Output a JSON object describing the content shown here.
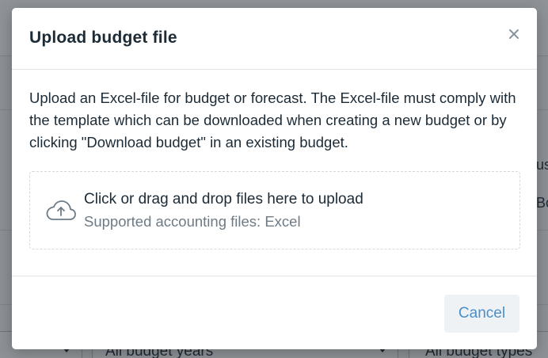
{
  "background": {
    "partial_header_1": "usi",
    "partial_cell_1": "Bo",
    "filters": {
      "budget_years": "All budget years",
      "budget_types": "All budget types"
    }
  },
  "modal": {
    "title": "Upload budget file",
    "close_icon": "close-icon",
    "description": "Upload an Excel-file for budget or forecast. The Excel-file must comply with the template which can be downloaded when creating a new budget or by clicking \"Download budget\" in an existing budget.",
    "dropzone": {
      "icon": "cloud-upload-icon",
      "title": "Click or drag and drop files here to upload",
      "subtitle": "Supported accounting files: Excel"
    },
    "footer": {
      "cancel_label": "Cancel"
    }
  },
  "colors": {
    "title_text": "#1c2b36",
    "muted_text": "#6f7b84",
    "accent": "#4a8fc7",
    "button_bg": "#eef2f5",
    "overlay": "#8c9094"
  }
}
